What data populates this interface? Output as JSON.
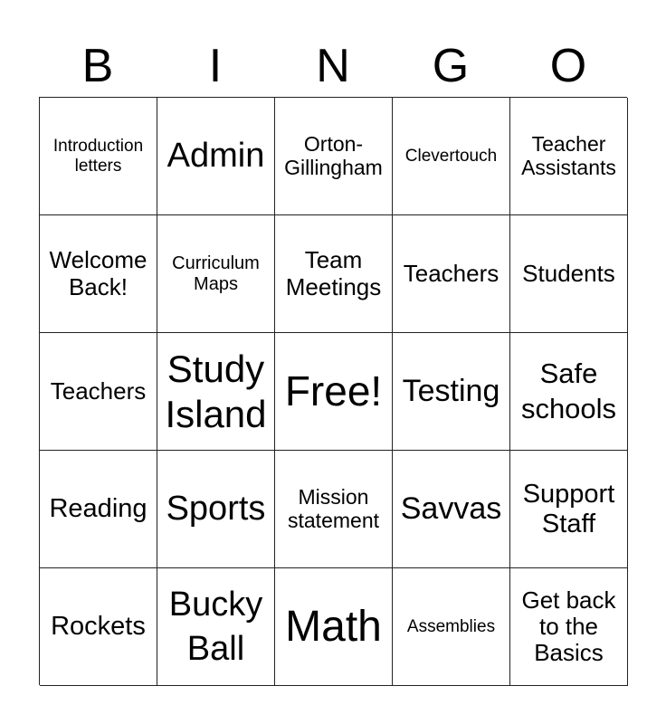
{
  "header": {
    "letters": [
      "B",
      "I",
      "N",
      "G",
      "O"
    ]
  },
  "board": {
    "rows": [
      [
        "Introduction\nletters",
        "Admin",
        "Orton-\nGillingham",
        "Clevertouch",
        "Teacher\nAssistants"
      ],
      [
        "Welcome\nBack!",
        "Curriculum\nMaps",
        "Team\nMeetings",
        "Teachers",
        "Students"
      ],
      [
        "Teachers",
        "Study\nIsland",
        "Free!",
        "Testing",
        "Safe\nschools"
      ],
      [
        "Reading",
        "Sports",
        "Mission\nstatement",
        "Savvas",
        "Support\nStaff"
      ],
      [
        "Rockets",
        "Bucky\nBall",
        "Math",
        "Assemblies",
        "Get back\nto the\nBasics"
      ]
    ]
  }
}
